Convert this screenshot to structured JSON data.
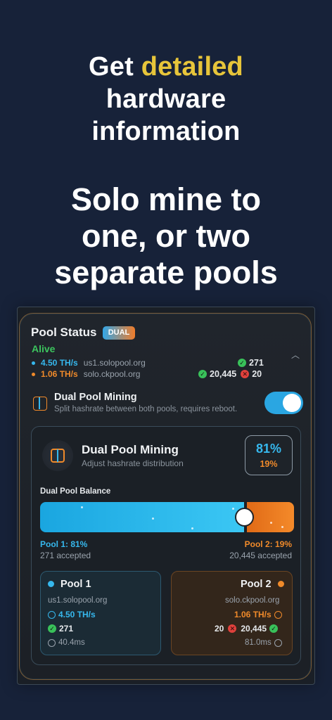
{
  "hero": {
    "line1_pre": "Get ",
    "line1_accent": "detailed",
    "line2": "hardware",
    "line3": "information",
    "sub_line1": "Solo mine to",
    "sub_line2": "one, or two",
    "sub_line3": "separate pools"
  },
  "pool_status": {
    "title": "Pool Status",
    "badge": "DUAL",
    "state": "Alive",
    "pool1": {
      "rate": "4.50 TH/s",
      "host": "us1.solopool.org",
      "accepted": "271"
    },
    "pool2": {
      "rate": "1.06 TH/s",
      "host": "solo.ckpool.org",
      "accepted": "20,445",
      "rejected": "20"
    }
  },
  "dual_mining": {
    "title": "Dual Pool Mining",
    "subtitle": "Split hashrate between both pools, requires reboot.",
    "enabled": true
  },
  "panel": {
    "title": "Dual Pool Mining",
    "subtitle": "Adjust hashrate distribution",
    "pct_pool1": "81%",
    "pct_pool2": "19%",
    "balance_label": "Dual Pool Balance",
    "balance_fraction": 0.81,
    "pool1_label": "Pool 1: 81%",
    "pool2_label": "Pool 2: 19%",
    "pool1_accepted": "271 accepted",
    "pool2_accepted": "20,445 accepted"
  },
  "cards": {
    "pool1": {
      "title": "Pool 1",
      "host": "us1.solopool.org",
      "rate": "4.50 TH/s",
      "accepted": "271",
      "latency": "40.4ms"
    },
    "pool2": {
      "title": "Pool 2",
      "host": "solo.ckpool.org",
      "rate": "1.06 TH/s",
      "rejected": "20",
      "accepted": "20,445",
      "latency": "81.0ms"
    }
  },
  "colors": {
    "accent": "#e7c53a",
    "pool1": "#36b8ee",
    "pool2": "#f08a2a",
    "ok": "#39c15a",
    "bad": "#e0413c"
  }
}
